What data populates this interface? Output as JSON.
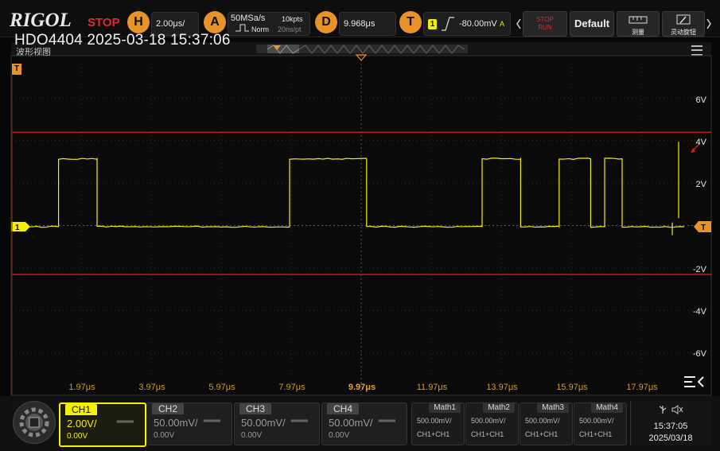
{
  "app": {
    "logo": "RIGOL",
    "run_state": "STOP",
    "device_line": "HDO4404 2025-03-18 15:37:06",
    "window_title": "波形视图"
  },
  "horizontal": {
    "badge": "H",
    "timebase": "2.00μs/"
  },
  "acquire": {
    "badge": "A",
    "sample_rate": "50MSa/s",
    "memory_depth": "10kpts",
    "mode": "Norm",
    "sample_interval": "20ns/pt"
  },
  "delay": {
    "badge": "D",
    "value": "9.968μs"
  },
  "trigger": {
    "badge": "T",
    "source": "1",
    "level": "-80.00mV",
    "source_letter": "A"
  },
  "right_buttons": {
    "stop_run": "STOP\nRUN",
    "default": "Default",
    "measure": "测量",
    "knob": "灵动旋钮"
  },
  "markers": {
    "trigger_pos": "T",
    "ch1": "1",
    "trig_level": "T"
  },
  "y_labels": [
    "6V",
    "4V",
    "2V",
    "-2V",
    "-4V",
    "-6V"
  ],
  "x_labels": [
    "1.97μs",
    "3.97μs",
    "5.97μs",
    "7.97μs",
    "9.97μs",
    "11.97μs",
    "13.97μs",
    "15.97μs",
    "17.97μs"
  ],
  "channels": [
    {
      "tab": "CH1",
      "scale": "2.00V/",
      "offset": "0.00V",
      "coupling": "═══",
      "active": true,
      "color": "#f5f000"
    },
    {
      "tab": "CH2",
      "scale": "50.00mV/",
      "offset": "0.00V",
      "coupling": "═══",
      "active": false,
      "color": "#9a9a9a"
    },
    {
      "tab": "CH3",
      "scale": "50.00mV/",
      "offset": "0.00V",
      "coupling": "═══",
      "active": false,
      "color": "#9a9a9a"
    },
    {
      "tab": "CH4",
      "scale": "50.00mV/",
      "offset": "0.00V",
      "coupling": "═══",
      "active": false,
      "color": "#9a9a9a"
    }
  ],
  "maths": [
    {
      "tab": "Math1",
      "scale": "500.00mV/",
      "expr": "CH1+CH1"
    },
    {
      "tab": "Math2",
      "scale": "500.00mV/",
      "expr": "CH1+CH1"
    },
    {
      "tab": "Math3",
      "scale": "500.00mV/",
      "expr": "CH1+CH1"
    },
    {
      "tab": "Math4",
      "scale": "500.00mV/",
      "expr": "CH1+CH1"
    }
  ],
  "clock": {
    "time": "15:37:05",
    "date": "2025/03/18"
  },
  "colors": {
    "ch1": "#f5f000",
    "accent": "#e8922a",
    "stop": "#e2282e",
    "limit": "#d02020"
  },
  "waveform": {
    "low_level_v": 0,
    "high_level_v": 3.2,
    "pulses_us": [
      [
        0.9,
        2.0
      ],
      [
        7.5,
        9.7
      ],
      [
        13.0,
        14.1
      ],
      [
        15.2,
        16.1
      ],
      [
        16.5,
        17.0
      ]
    ]
  }
}
